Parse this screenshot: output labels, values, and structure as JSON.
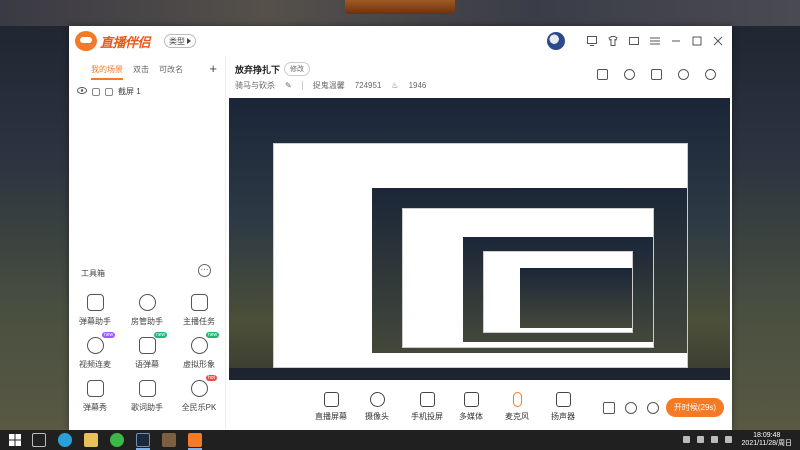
{
  "app": {
    "logo_text": "直播伴侣",
    "mode_label": "类型"
  },
  "scene_tabs": [
    {
      "label": "我的场景",
      "active": true
    },
    {
      "label": "双击",
      "active": false
    },
    {
      "label": "可改名",
      "active": false
    }
  ],
  "source": {
    "label": "截屏 1"
  },
  "toolbox": {
    "title": "工具箱",
    "items": [
      {
        "label": "弹幕助手",
        "icon": "barrage-icon",
        "badge": ""
      },
      {
        "label": "房管助手",
        "icon": "admin-icon",
        "badge": ""
      },
      {
        "label": "主播任务",
        "icon": "task-icon",
        "badge": ""
      },
      {
        "label": "视频连麦",
        "icon": "video-link-icon",
        "badge": "new"
      },
      {
        "label": "语弹幕",
        "icon": "voice-barrage-icon",
        "badge": "new"
      },
      {
        "label": "虚拟形象",
        "icon": "avatar-virtual-icon",
        "badge": "new"
      },
      {
        "label": "弹幕秀",
        "icon": "barrage-show-icon",
        "badge": ""
      },
      {
        "label": "歌词助手",
        "icon": "lyrics-icon",
        "badge": ""
      },
      {
        "label": "全民乐PK",
        "icon": "pk-icon",
        "badge": "hot"
      }
    ]
  },
  "stream": {
    "title": "放弃挣扎下",
    "edit_label": "修改",
    "category": "骑马与砍杀",
    "channel": "捉鬼温馨",
    "room_id": "724951",
    "viewers": "1946"
  },
  "controls": [
    {
      "label": "直播屏幕",
      "icon": "screen-icon"
    },
    {
      "label": "摄像头",
      "icon": "camera-icon"
    },
    {
      "label": "手机投屏",
      "icon": "phone-cast-icon"
    },
    {
      "label": "多媒体",
      "icon": "multimedia-icon"
    },
    {
      "label": "麦克风",
      "icon": "microphone-icon"
    },
    {
      "label": "扬声器",
      "icon": "speaker-icon"
    }
  ],
  "live_button": {
    "label": "开时候(29s)"
  },
  "system": {
    "time": "18:09:48",
    "date": "2021/11/28/周日"
  },
  "colors": {
    "accent": "#f47a26"
  }
}
